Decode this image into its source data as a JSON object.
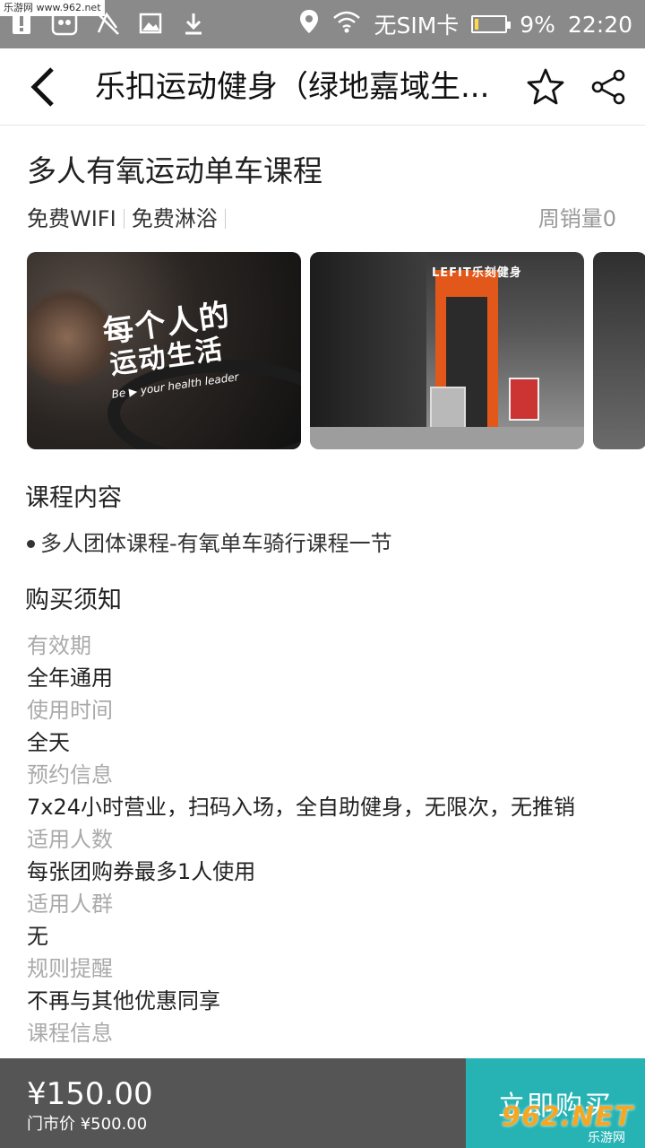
{
  "status_bar": {
    "carrier": "无SIM卡",
    "battery": "9%",
    "time": "22:20",
    "watermark": "乐游网 www.962.net"
  },
  "header": {
    "title": "乐扣运动健身（绿地嘉域生..."
  },
  "product": {
    "title": "多人有氧运动单车课程",
    "features": [
      "免费WIFI",
      "免费淋浴"
    ],
    "sales_label": "周销量",
    "sales_count": "0"
  },
  "gallery": {
    "photo1": {
      "line1": "每个人的",
      "line2": "运动生活",
      "line3": "Be ▶ your health leader"
    },
    "photo2": {
      "sign": "LEFIT乐刻健身"
    }
  },
  "course_content": {
    "title": "课程内容",
    "item": "多人团体课程-有氧单车骑行课程一节"
  },
  "notice": {
    "title": "购买须知",
    "items": [
      {
        "label": "有效期",
        "value": "全年通用"
      },
      {
        "label": "使用时间",
        "value": "全天"
      },
      {
        "label": "预约信息",
        "value": "7x24小时营业，扫码入场，全自助健身，无限次，无推销"
      },
      {
        "label": "适用人数",
        "value": "每张团购券最多1人使用"
      },
      {
        "label": "适用人群",
        "value": "无"
      },
      {
        "label": "规则提醒",
        "value": "不再与其他优惠同享"
      },
      {
        "label": "课程信息",
        "value": ""
      }
    ]
  },
  "bottom": {
    "price": "¥150.00",
    "original_price": "门市价 ¥500.00",
    "buy_label": "立即购买"
  },
  "watermark": {
    "brand": "962.NET",
    "sub": "乐游网"
  },
  "colors": {
    "buy_button": "#27b3b4",
    "price_bar": "#555555",
    "status_bar": "#8a8a8a"
  }
}
